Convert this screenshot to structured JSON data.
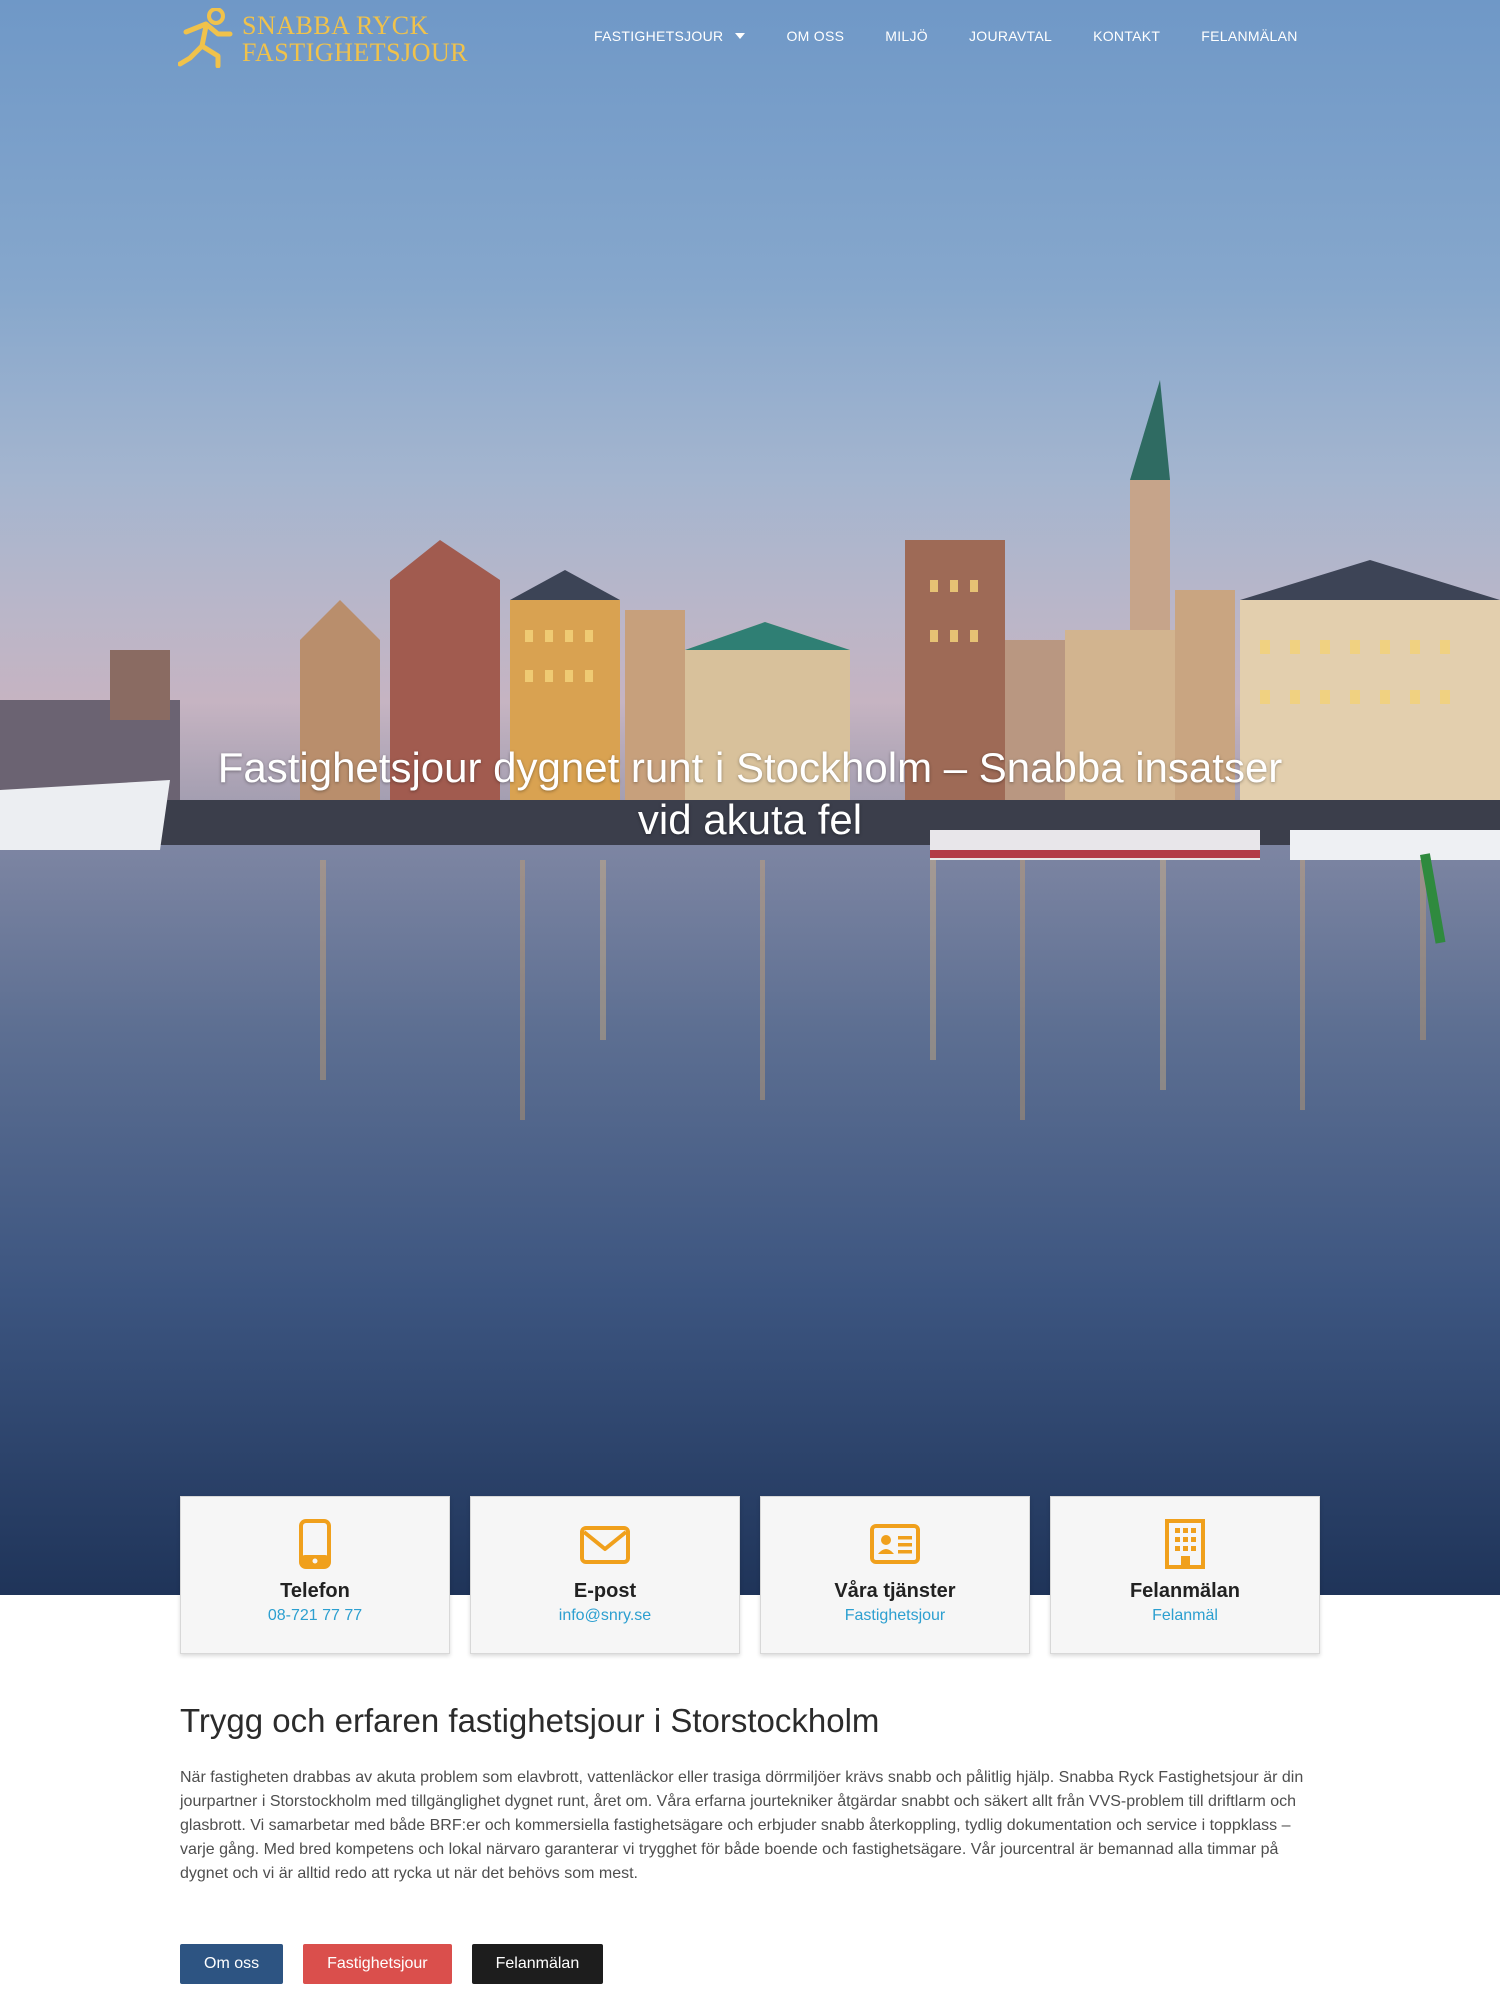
{
  "brand": {
    "line1": "SNABBA RYCK",
    "line2": "FASTIGHETSJOUR"
  },
  "nav": [
    {
      "label": "FASTIGHETSJOUR",
      "dropdown": true
    },
    {
      "label": "OM OSS"
    },
    {
      "label": "MILJÖ"
    },
    {
      "label": "JOURAVTAL"
    },
    {
      "label": "KONTAKT"
    },
    {
      "label": "FELANMÄLAN"
    }
  ],
  "hero": {
    "title": "Fastighetsjour dygnet runt i Stockholm – Snabba insatser vid akuta fel"
  },
  "cards": [
    {
      "icon": "phone-icon",
      "title": "Telefon",
      "link": "08-721 77 77"
    },
    {
      "icon": "envelope-icon",
      "title": "E-post",
      "link": "info@snry.se"
    },
    {
      "icon": "id-card-icon",
      "title": "Våra tjänster",
      "link": "Fastighetsjour"
    },
    {
      "icon": "building-icon",
      "title": "Felanmälan",
      "link": "Felanmäl"
    }
  ],
  "intro": {
    "title": "Trygg och erfaren fastighetsjour i Storstockholm",
    "text": "När fastigheten drabbas av akuta problem som elavbrott, vattenläckor eller trasiga dörrmiljöer krävs snabb och pålitlig hjälp. Snabba Ryck Fastighetsjour är din jourpartner i Storstockholm med tillgänglighet dygnet runt, året om. Våra erfarna jourtekniker åtgärdar snabbt och säkert allt från VVS-problem till driftlarm och glasbrott. Vi samarbetar med både BRF:er och kommersiella fastighetsägare och erbjuder snabb återkoppling, tydlig dokumentation och service i toppklass – varje gång. Med bred kompetens och lokal närvaro garanterar vi trygghet för både boende och fastighetsägare. Vår jourcentral är bemannad alla timmar på dygnet och vi är alltid redo att rycka ut när det behövs som mest."
  },
  "buttons": {
    "about": "Om oss",
    "service": "Fastighetsjour",
    "report": "Felanmälan"
  },
  "colors": {
    "accent": "#f0a01c",
    "link": "#2c9fd0",
    "logo": "#f0c24b",
    "btn_blue": "#2d5482",
    "btn_red": "#da4f4c",
    "btn_black": "#1d1d1d"
  }
}
